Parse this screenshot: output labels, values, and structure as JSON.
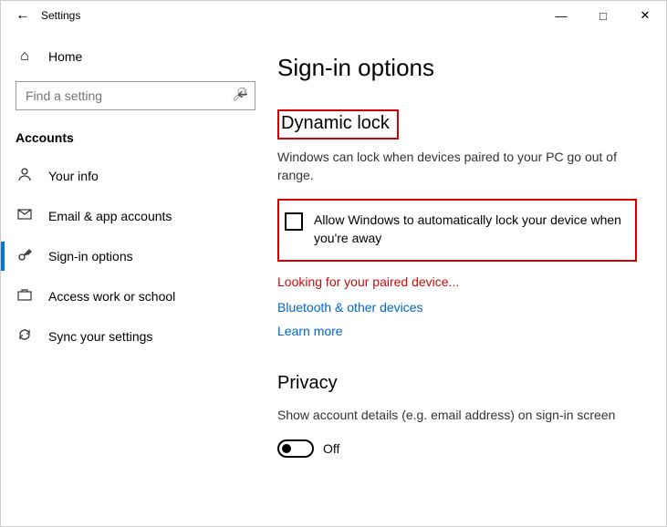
{
  "window": {
    "title": "Settings"
  },
  "sidebar": {
    "home": "Home",
    "search_placeholder": "Find a setting",
    "group": "Accounts",
    "items": [
      {
        "icon": "person-icon",
        "label": "Your info"
      },
      {
        "icon": "mail-icon",
        "label": "Email & app accounts"
      },
      {
        "icon": "key-icon",
        "label": "Sign-in options"
      },
      {
        "icon": "briefcase-icon",
        "label": "Access work or school"
      },
      {
        "icon": "sync-icon",
        "label": "Sync your settings"
      }
    ]
  },
  "main": {
    "title": "Sign-in options",
    "dynamic_lock": {
      "heading": "Dynamic lock",
      "description": "Windows can lock when devices paired to your PC go out of range.",
      "checkbox_label": "Allow Windows to automatically lock your device when you're away",
      "status": "Looking for your paired device...",
      "link1": "Bluetooth & other devices",
      "link2": "Learn more"
    },
    "privacy": {
      "heading": "Privacy",
      "description": "Show account details (e.g. email address) on sign-in screen",
      "toggle_state": "Off"
    }
  }
}
